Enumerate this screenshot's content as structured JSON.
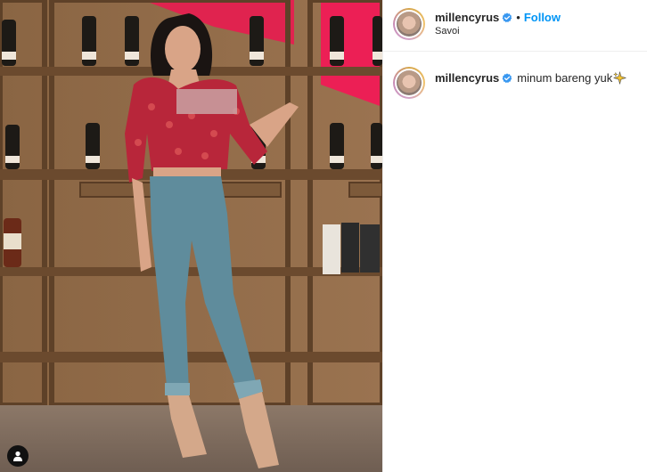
{
  "post": {
    "username": "millencyrus",
    "location": "Savoi",
    "follow_label": "Follow",
    "separator": "•",
    "caption_username": "millencyrus",
    "caption_text": "minum bareng yuk"
  },
  "icons": {
    "verified": "verified-badge-icon",
    "sparkle": "sparkle-emoji-icon",
    "tag": "user-tag-icon"
  },
  "colors": {
    "follow": "#0095f6",
    "verified": "#3897f0",
    "text": "#262626",
    "divider": "#efefef"
  }
}
